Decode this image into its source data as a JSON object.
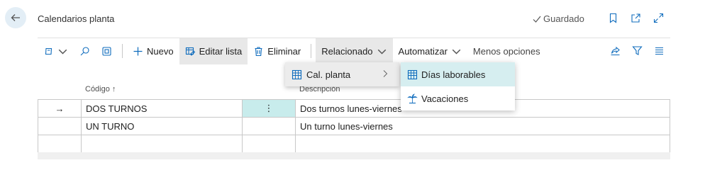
{
  "header": {
    "title": "Calendarios planta",
    "saved_label": "Guardado"
  },
  "toolbar": {
    "new_label": "Nuevo",
    "edit_list_label": "Editar lista",
    "delete_label": "Eliminar",
    "related_label": "Relacionado",
    "automate_label": "Automatizar",
    "fewer_options_label": "Menos opciones"
  },
  "menu": {
    "level1": {
      "label": "Cal. planta"
    },
    "level2": [
      {
        "label": "Días laborables",
        "icon": "calendar-grid-icon",
        "highlighted": true
      },
      {
        "label": "Vacaciones",
        "icon": "palm-tree-icon",
        "highlighted": false
      }
    ]
  },
  "table": {
    "columns": [
      "Código",
      "Descripción"
    ],
    "sort_indicator": "↑",
    "rows": [
      {
        "code": "DOS TURNOS",
        "description": "Dos turnos lunes-viernes",
        "current": true
      },
      {
        "code": "UN TURNO",
        "description": "Un turno lunes-viernes",
        "current": false
      },
      {
        "code": "",
        "description": "",
        "current": false
      }
    ],
    "row_marker": "→",
    "row_menu": "⋮"
  },
  "colors": {
    "accent": "#0f6cbd",
    "selected_cell": "#c8ecec",
    "menu_highlight": "#d6eef0",
    "back_button_bg": "#e3eef6"
  }
}
